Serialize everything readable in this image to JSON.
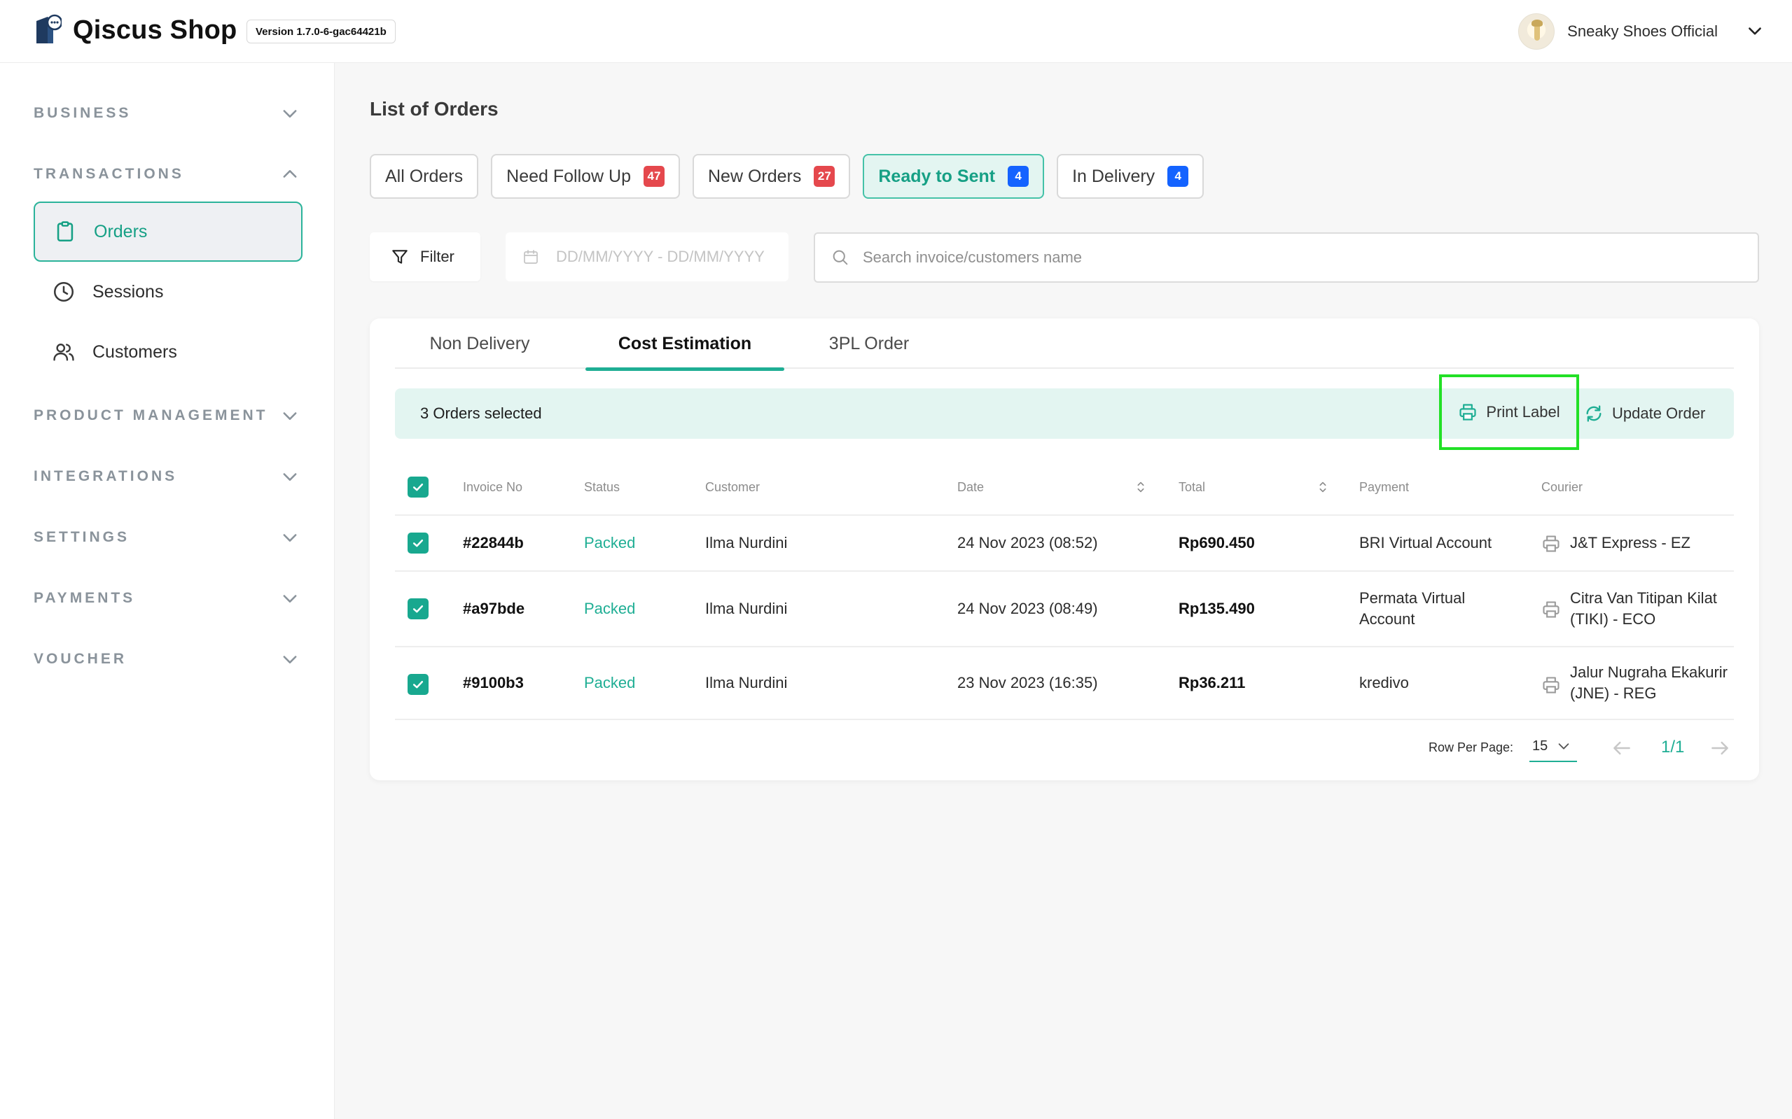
{
  "app": {
    "name": "Qiscus Shop",
    "version": "Version 1.7.0-6-gac64421b",
    "account_name": "Sneaky Shoes Official"
  },
  "sidebar": {
    "sections": [
      {
        "label": "BUSINESS",
        "expanded": false
      },
      {
        "label": "TRANSACTIONS",
        "expanded": true
      },
      {
        "label": "PRODUCT MANAGEMENT",
        "expanded": false
      },
      {
        "label": "INTEGRATIONS",
        "expanded": false
      },
      {
        "label": "SETTINGS",
        "expanded": false
      },
      {
        "label": "PAYMENTS",
        "expanded": false
      },
      {
        "label": "VOUCHER",
        "expanded": false
      }
    ],
    "transaction_items": [
      {
        "label": "Orders",
        "icon": "clipboard-icon",
        "active": true
      },
      {
        "label": "Sessions",
        "icon": "clock-icon",
        "active": false
      },
      {
        "label": "Customers",
        "icon": "users-icon",
        "active": false
      }
    ]
  },
  "main": {
    "title": "List of Orders",
    "status_tabs": [
      {
        "label": "All Orders",
        "count": null
      },
      {
        "label": "Need Follow Up",
        "count": "47"
      },
      {
        "label": "New Orders",
        "count": "27"
      },
      {
        "label": "Ready to Sent",
        "count": "4",
        "active": true
      },
      {
        "label": "In Delivery",
        "count": "4"
      }
    ],
    "filter_label": "Filter",
    "date_placeholder": "DD/MM/YYYY - DD/MM/YYYY",
    "search_placeholder": "Search invoice/customers name"
  },
  "orders": {
    "subtabs": [
      {
        "label": "Non Delivery"
      },
      {
        "label": "Cost Estimation",
        "active": true
      },
      {
        "label": "3PL Order"
      }
    ],
    "selection_text": "3 Orders selected",
    "print_label": "Print Label",
    "update_order": "Update Order",
    "columns": {
      "invoice": "Invoice No",
      "status": "Status",
      "customer": "Customer",
      "date": "Date",
      "total": "Total",
      "payment": "Payment",
      "courier": "Courier"
    },
    "rows": [
      {
        "invoice": "#22844b",
        "status": "Packed",
        "customer": "Ilma Nurdini",
        "date": "24 Nov 2023 (08:52)",
        "total": "Rp690.450",
        "payment": "BRI Virtual Account",
        "courier": "J&T Express - EZ",
        "checked": true
      },
      {
        "invoice": "#a97bde",
        "status": "Packed",
        "customer": "Ilma Nurdini",
        "date": "24 Nov 2023 (08:49)",
        "total": "Rp135.490",
        "payment": "Permata Virtual Account",
        "courier": "Citra Van Titipan Kilat (TIKI) - ECO",
        "checked": true
      },
      {
        "invoice": "#9100b3",
        "status": "Packed",
        "customer": "Ilma Nurdini",
        "date": "23 Nov 2023 (16:35)",
        "total": "Rp36.211",
        "payment": "kredivo",
        "courier": "Jalur Nugraha Ekakurir (JNE) - REG",
        "checked": true
      }
    ],
    "pagination": {
      "rows_per_page_label": "Row Per Page:",
      "rows_per_page": "15",
      "page": "1/1"
    }
  },
  "colors": {
    "accent": "#1fae94",
    "accent_bg": "#e3f5f1",
    "badge_red": "#e5484d",
    "badge_blue": "#1463ff",
    "highlight": "#22e026"
  }
}
